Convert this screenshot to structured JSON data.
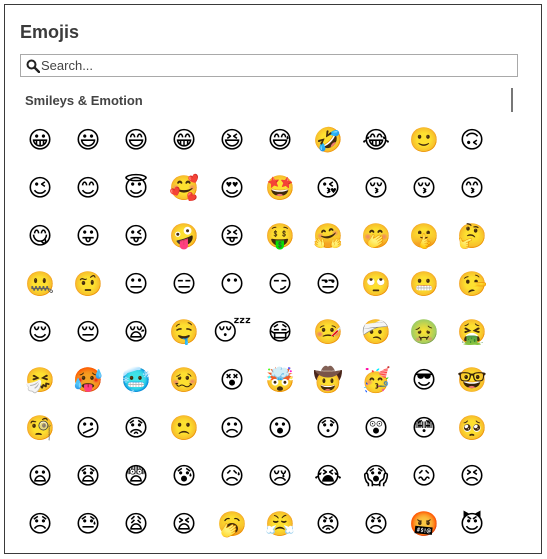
{
  "panel": {
    "title": "Emojis",
    "search": {
      "placeholder": "Search...",
      "value": "",
      "icon": "magnifier-icon"
    },
    "section_title": "Smileys & Emotion"
  },
  "emojis": [
    [
      "😀",
      "😃",
      "😄",
      "😁",
      "😆",
      "😅",
      "🤣",
      "😂",
      "🙂",
      "🙃"
    ],
    [
      "😉",
      "😊",
      "😇",
      "🥰",
      "😍",
      "🤩",
      "😘",
      "😚",
      "😚",
      "😙"
    ],
    [
      "😋",
      "😛",
      "😜",
      "🤪",
      "😝",
      "🤑",
      "🤗",
      "🤭",
      "🤫",
      "🤔"
    ],
    [
      "🤐",
      "🤨",
      "😐",
      "😑",
      "😶",
      "😏",
      "😒",
      "🙄",
      "😬",
      "🤥"
    ],
    [
      "😌",
      "😔",
      "😪",
      "🤤",
      "😴",
      "😷",
      "🤒",
      "🤕",
      "🤢",
      "🤮"
    ],
    [
      "🤧",
      "🥵",
      "🥶",
      "🥴",
      "😵",
      "🤯",
      "🤠",
      "🥳",
      "😎",
      "🤓"
    ],
    [
      "🧐",
      "😕",
      "😟",
      "🙁",
      "☹",
      "😮",
      "😯",
      "😲",
      "😳",
      "🥺"
    ],
    [
      "😦",
      "😧",
      "😨",
      "😰",
      "😥",
      "😢",
      "😭",
      "😱",
      "😖",
      "😣"
    ],
    [
      "😞",
      "😓",
      "😩",
      "😫",
      "🥱",
      "😤",
      "😡",
      "😠",
      "🤬",
      "😈"
    ]
  ]
}
